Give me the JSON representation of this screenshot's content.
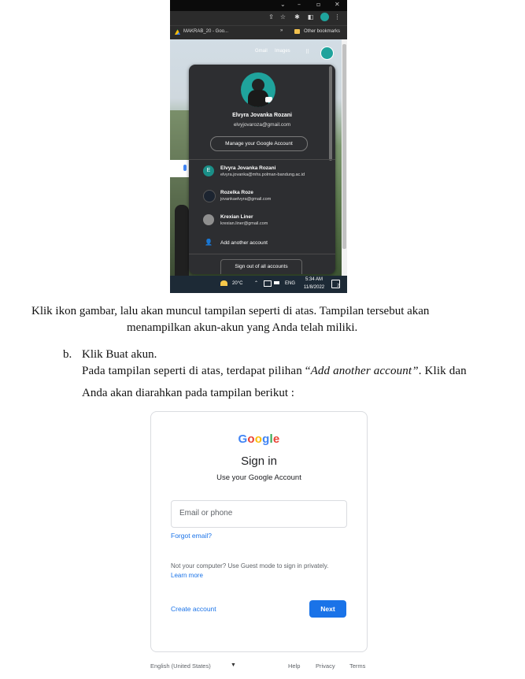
{
  "screenshot1": {
    "tab_title": "MAKRAB_20 - Goo...",
    "bookmarks_more": "»",
    "other_bookmarks": "Other bookmarks",
    "window_controls": [
      "⌄",
      "–",
      "▫",
      "✕"
    ],
    "google_links": [
      "Gmail",
      "Images"
    ],
    "account_panel": {
      "name": "Elvyra Jovanka Rozani",
      "email": "elvyjovaroza@gmail.com",
      "manage_label": "Manage your Google Account",
      "accounts": [
        {
          "initial": "E",
          "name": "Elvyra Jovanka Rozani",
          "email": "elvyra.jovanka@mhs.polman-bandung.ac.id",
          "color": "#1a8f88"
        },
        {
          "initial": "",
          "name": "Rozelka Roze",
          "email": "jovankaelvyra@gmail.com",
          "color": "#1c2430"
        },
        {
          "initial": "",
          "name": "Krexian Liner",
          "email": "krexian.liner@gmail.com",
          "color": "#8f8f8f"
        }
      ],
      "add_account_label": "Add another account",
      "signout_label": "Sign out of all accounts"
    },
    "taskbar": {
      "temperature": "20°C",
      "language": "ENG",
      "time": "5:34 AM",
      "date": "11/8/2022",
      "notification_count": "2"
    }
  },
  "text": {
    "caption_line1": "Klik ikon gambar, lalu akan muncul tampilan seperti di atas. Tampilan tersebut akan",
    "caption_line2": "menampilkan akun-akun yang Anda telah miliki.",
    "step_marker": "b.",
    "step_title": "Klik Buat akun.",
    "step_desc_before": "Pada tampilan seperti di atas, terdapat pilihan “",
    "step_desc_italic": "Add another account”",
    "step_desc_after": ". Klik dan",
    "step_desc_line2": "Anda akan diarahkan pada tampilan berikut :"
  },
  "screenshot2": {
    "logo_letters": [
      {
        "ch": "G",
        "color": "#4285f4"
      },
      {
        "ch": "o",
        "color": "#ea4335"
      },
      {
        "ch": "o",
        "color": "#fbbc05"
      },
      {
        "ch": "g",
        "color": "#4285f4"
      },
      {
        "ch": "l",
        "color": "#34a853"
      },
      {
        "ch": "e",
        "color": "#ea4335"
      }
    ],
    "title": "Sign in",
    "subtitle": "Use your Google Account",
    "email_placeholder": "Email or phone",
    "forgot_email": "Forgot email?",
    "guest_note": "Not your computer? Use Guest mode to sign in privately.",
    "learn_more": "Learn more",
    "create_account": "Create account",
    "next_label": "Next",
    "footer": {
      "language": "English (United States)",
      "help": "Help",
      "privacy": "Privacy",
      "terms": "Terms"
    }
  }
}
